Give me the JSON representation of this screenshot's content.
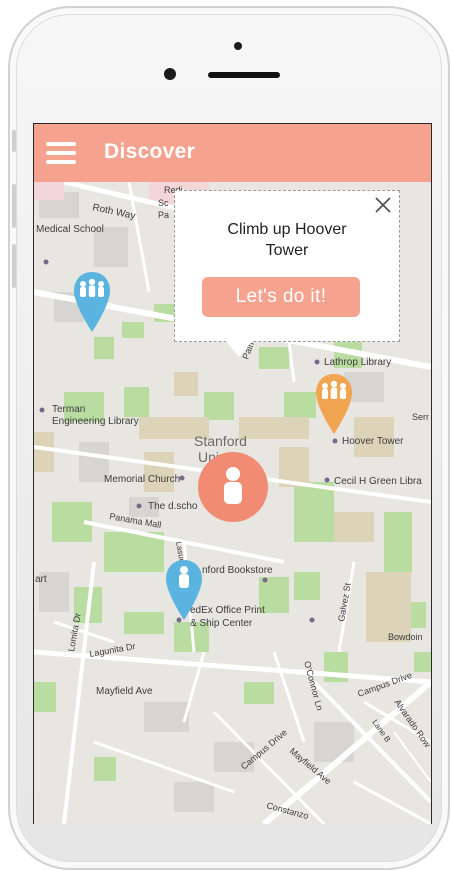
{
  "header": {
    "title": "Discover"
  },
  "popup": {
    "text_line1": "Climb up Hoover",
    "text_line2": "Tower",
    "action_label": "Let's do it!"
  },
  "map": {
    "labels": {
      "roth_way": "Roth Way",
      "medical_school": "Medical School",
      "redi": "Redi",
      "sc": "Sc",
      "pa": "Pa",
      "palm": "Palm",
      "lathrop_library": "Lathrop Library",
      "terman_1": "Terman",
      "terman_2": "Engineering Library",
      "stanford_1": "Stanford",
      "stanford_2": "Univ",
      "hoover_tower": "Hoover Tower",
      "memorial_church": "Memorial Church",
      "cecil": "Cecil H Green Libra",
      "the_d_school": "The d.scho",
      "panama_mall": "Panama Mall",
      "bookstore": "nford Bookstore",
      "lasuen_st": "Lasuen St",
      "fedex_1": "edEx Office Print",
      "fedex_2": "& Ship Center",
      "lomita_dr": "Lomita Dr",
      "lagunita_dr": "Lagunita Dr",
      "mayfield_ave": "Mayfield Ave",
      "campus_drive_east": "Campus Drive",
      "campus_drive": "Campus Drive",
      "mayfield_ave2": "Mayfield Ave",
      "oconnor": "O'Connor Ln",
      "alvarado_row": "Alvarado Row",
      "lane_b": "Lane B",
      "galvez_st": "Galvez St",
      "bowdoin": "Bowdoin",
      "serra": "Serr",
      "constanzo": "Constanzo",
      "art": "art"
    }
  },
  "colors": {
    "accent": "#f5a28e",
    "user_pin": "#f28b73",
    "pin_blue": "#5bb4e0",
    "pin_orange": "#f2a550"
  },
  "icons": {
    "menu": "hamburger-menu-icon",
    "close": "close-icon",
    "group_pin": "group-people-pin-icon",
    "user_pin": "person-icon"
  }
}
